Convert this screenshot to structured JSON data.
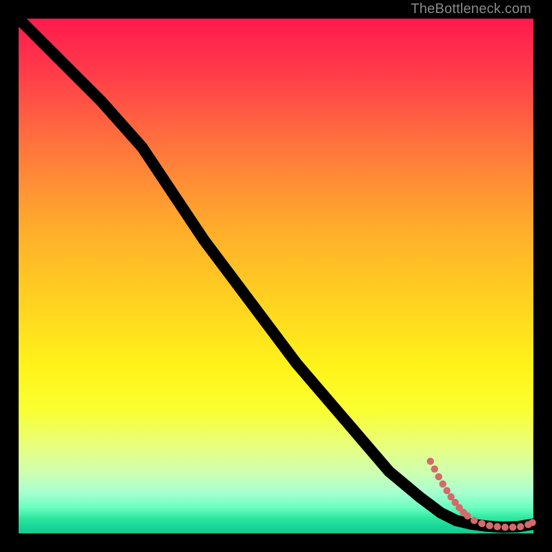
{
  "watermark": "TheBottleneck.com",
  "colors": {
    "frame_bg": "#000000",
    "curve": "#000000",
    "dot": "#d46a6a"
  },
  "chart_data": {
    "type": "line",
    "title": "",
    "xlabel": "",
    "ylabel": "",
    "xlim": [
      0,
      100
    ],
    "ylim": [
      0,
      100
    ],
    "grid": false,
    "series": [
      {
        "name": "curve",
        "x": [
          0,
          8,
          16,
          24,
          30,
          36,
          42,
          48,
          54,
          60,
          66,
          72,
          78,
          82,
          85,
          88,
          91,
          94,
          97,
          100
        ],
        "y": [
          100,
          92,
          84,
          75,
          66,
          57,
          49,
          41,
          33,
          26,
          19,
          12,
          7,
          4,
          2.5,
          1.8,
          1.4,
          1.2,
          1.3,
          1.8
        ]
      }
    ],
    "points": [
      {
        "x": 80.0,
        "y": 14.0
      },
      {
        "x": 80.8,
        "y": 12.5
      },
      {
        "x": 81.6,
        "y": 11.0
      },
      {
        "x": 82.4,
        "y": 9.6
      },
      {
        "x": 83.2,
        "y": 8.3
      },
      {
        "x": 84.0,
        "y": 7.1
      },
      {
        "x": 84.8,
        "y": 6.0
      },
      {
        "x": 85.6,
        "y": 5.0
      },
      {
        "x": 86.4,
        "y": 4.1
      },
      {
        "x": 87.2,
        "y": 3.4
      },
      {
        "x": 88.5,
        "y": 2.5
      },
      {
        "x": 90.0,
        "y": 1.9
      },
      {
        "x": 91.5,
        "y": 1.5
      },
      {
        "x": 93.0,
        "y": 1.3
      },
      {
        "x": 94.5,
        "y": 1.2
      },
      {
        "x": 96.0,
        "y": 1.2
      },
      {
        "x": 97.5,
        "y": 1.3
      },
      {
        "x": 99.0,
        "y": 1.7
      },
      {
        "x": 99.8,
        "y": 2.1
      }
    ]
  }
}
